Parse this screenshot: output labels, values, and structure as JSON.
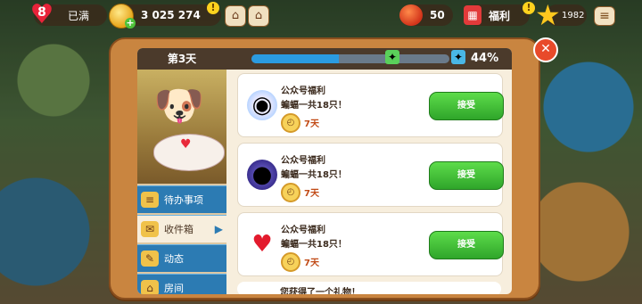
{
  "hud": {
    "lives_count": "8",
    "lives_label": "已满",
    "coins": "3 025 274",
    "coins_badge": "!",
    "tomato_count": "50",
    "benefit_label": "福利",
    "benefit_badge": "!",
    "stars": "1982",
    "icons": [
      "heart-icon",
      "coin-icon",
      "gamepad-icon",
      "home-icon",
      "tomato-icon",
      "calendar-icon",
      "star-icon",
      "menu-icon"
    ]
  },
  "modal": {
    "day_label": "第3天",
    "progress_percent": 44,
    "progress_text": "44%",
    "close_label": "✕",
    "left_menu": [
      {
        "label": "待办事项",
        "icon": "todo-icon"
      },
      {
        "label": "收件箱",
        "icon": "inbox-icon",
        "active": true,
        "arrow": "▶"
      },
      {
        "label": "动态",
        "icon": "news-icon"
      },
      {
        "label": "房间",
        "icon": "room-icon"
      }
    ],
    "cards": [
      {
        "title": "公众号福利",
        "desc": "蝙蝠一共18只！",
        "days": "7天",
        "button": "接受",
        "icon": "rainbow-orb-icon"
      },
      {
        "title": "公众号福利",
        "desc": "蝙蝠一共18只！",
        "days": "7天",
        "button": "接受",
        "icon": "ornament-bombs-icon"
      },
      {
        "title": "公众号福利",
        "desc": "蝙蝠一共18只！",
        "days": "7天",
        "button": "接受",
        "icon": "red-heart-icon"
      }
    ],
    "partial_message": "您获得了一个礼物！"
  }
}
